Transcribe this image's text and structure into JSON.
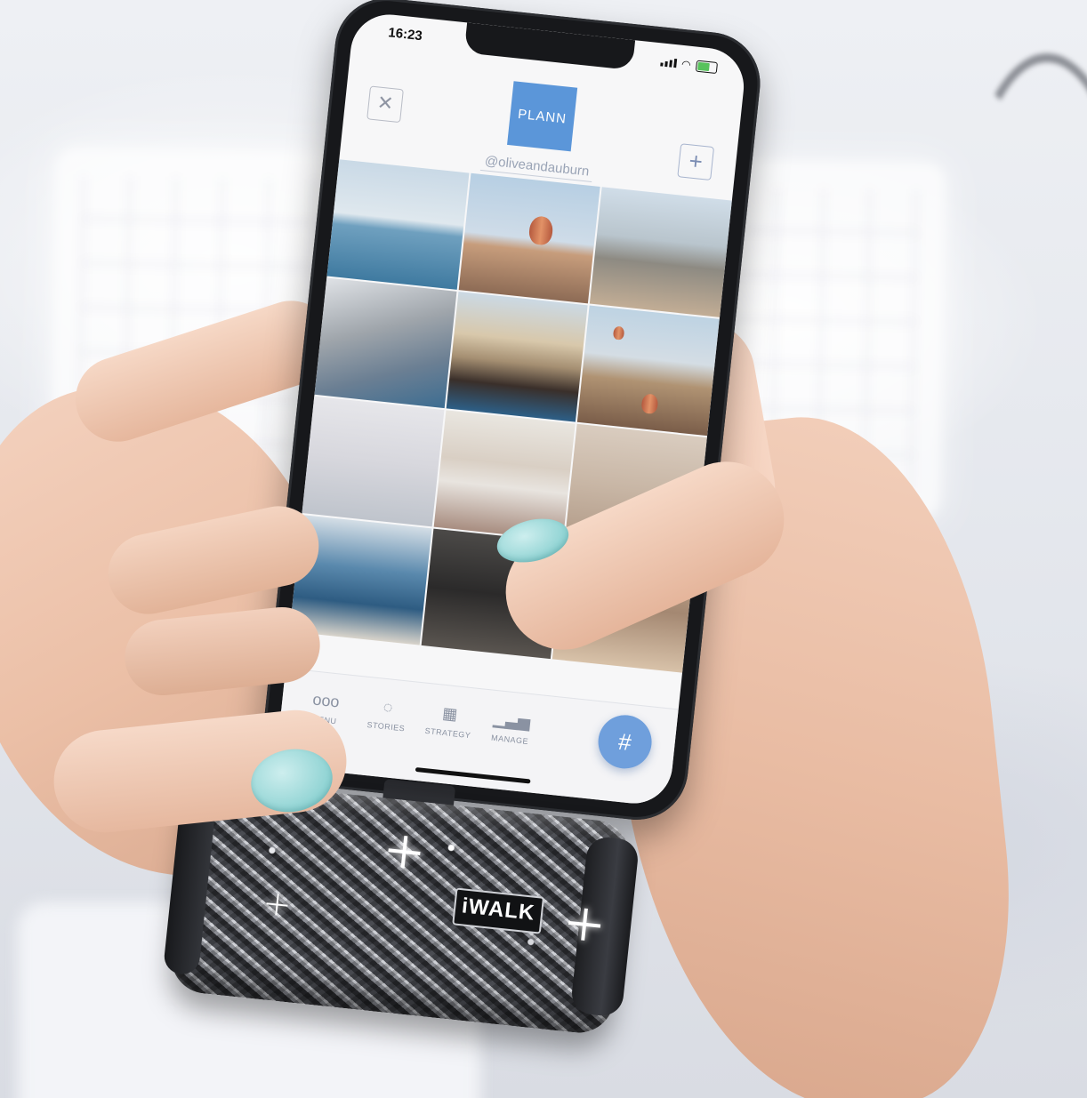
{
  "status_bar": {
    "time": "16:23"
  },
  "app": {
    "logo_text": "PLANN",
    "handle": "@oliveandauburn",
    "close_icon_glyph": "✕",
    "add_icon_glyph": "+"
  },
  "tabbar": {
    "items": [
      {
        "label": "MENU",
        "icon": "ooo"
      },
      {
        "label": "STORIES",
        "icon": "◌"
      },
      {
        "label": "STRATEGY",
        "icon": "▦"
      },
      {
        "label": "MANAGE",
        "icon": "▁▃▅"
      }
    ],
    "fab_icon": "#"
  },
  "product": {
    "brand": "iWALK"
  },
  "colors": {
    "accent": "#5b96d9",
    "fab": "#6f9fdc",
    "nail_polish": "#8fd3d3"
  }
}
